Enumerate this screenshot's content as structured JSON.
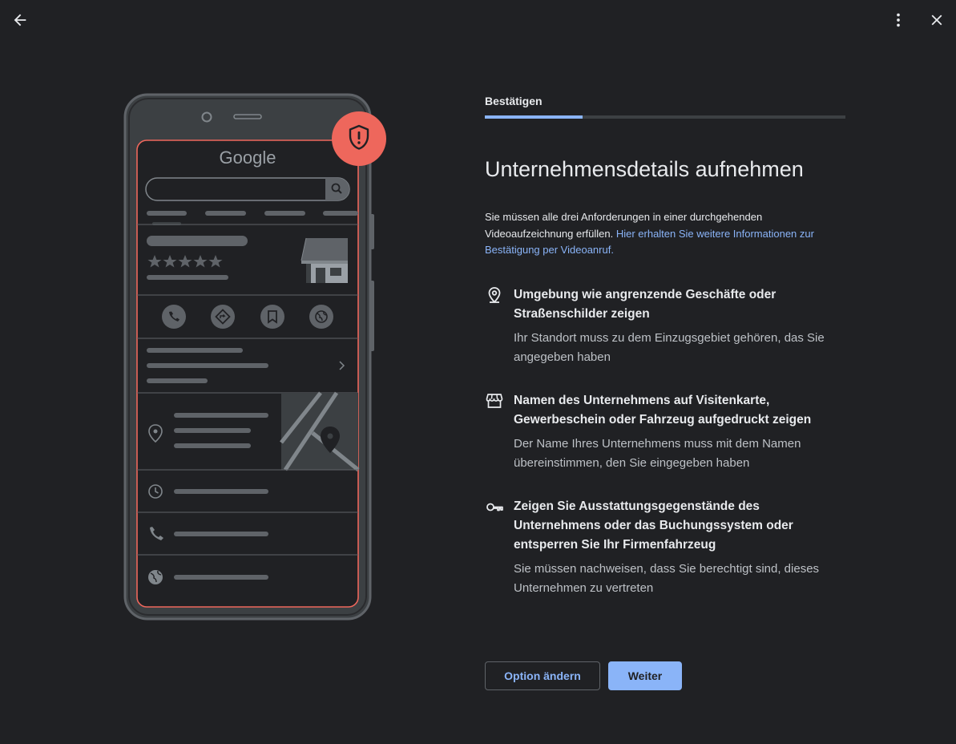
{
  "topbar": {
    "back_icon": "arrow-left-icon",
    "more_icon": "more-vert-icon",
    "close_icon": "close-icon"
  },
  "illustration": {
    "logo_text": "Google",
    "badge_icon": "shield-alert-icon",
    "accent_color": "#ee675c"
  },
  "step": {
    "label": "Bestätigen",
    "progress_fraction": 0.27
  },
  "title": "Unternehmensdetails aufnehmen",
  "intro": {
    "text": "Sie müssen alle drei Anforderungen in einer durchgehenden Videoaufzeichnung erfüllen. ",
    "link": "Hier erhalten Sie weitere Informationen zur Bestätigung per Videoanruf."
  },
  "requirements": [
    {
      "icon": "location-pin-icon",
      "title": "Umgebung wie angrenzende Geschäfte oder Straßenschilder zeigen",
      "desc": "Ihr Standort muss zu dem Einzugsgebiet gehören, das Sie angegeben haben"
    },
    {
      "icon": "storefront-icon",
      "title": "Namen des Unternehmens auf Visitenkarte, Gewerbeschein oder Fahrzeug aufgedruckt zeigen",
      "desc": "Der Name Ihres Unternehmens muss mit dem Namen übereinstimmen, den Sie eingegeben haben"
    },
    {
      "icon": "key-icon",
      "title": "Zeigen Sie Ausstattungsgegenstände des Unternehmens oder das Buchungssystem oder entsperren Sie Ihr Firmenfahrzeug",
      "desc": "Sie müssen nachweisen, dass Sie berechtigt sind, dieses Unternehmen zu vertreten"
    }
  ],
  "buttons": {
    "change_option": "Option ändern",
    "next": "Weiter"
  },
  "colors": {
    "background": "#202124",
    "accent_blue": "#8ab4f8",
    "badge_red": "#ee675c"
  }
}
